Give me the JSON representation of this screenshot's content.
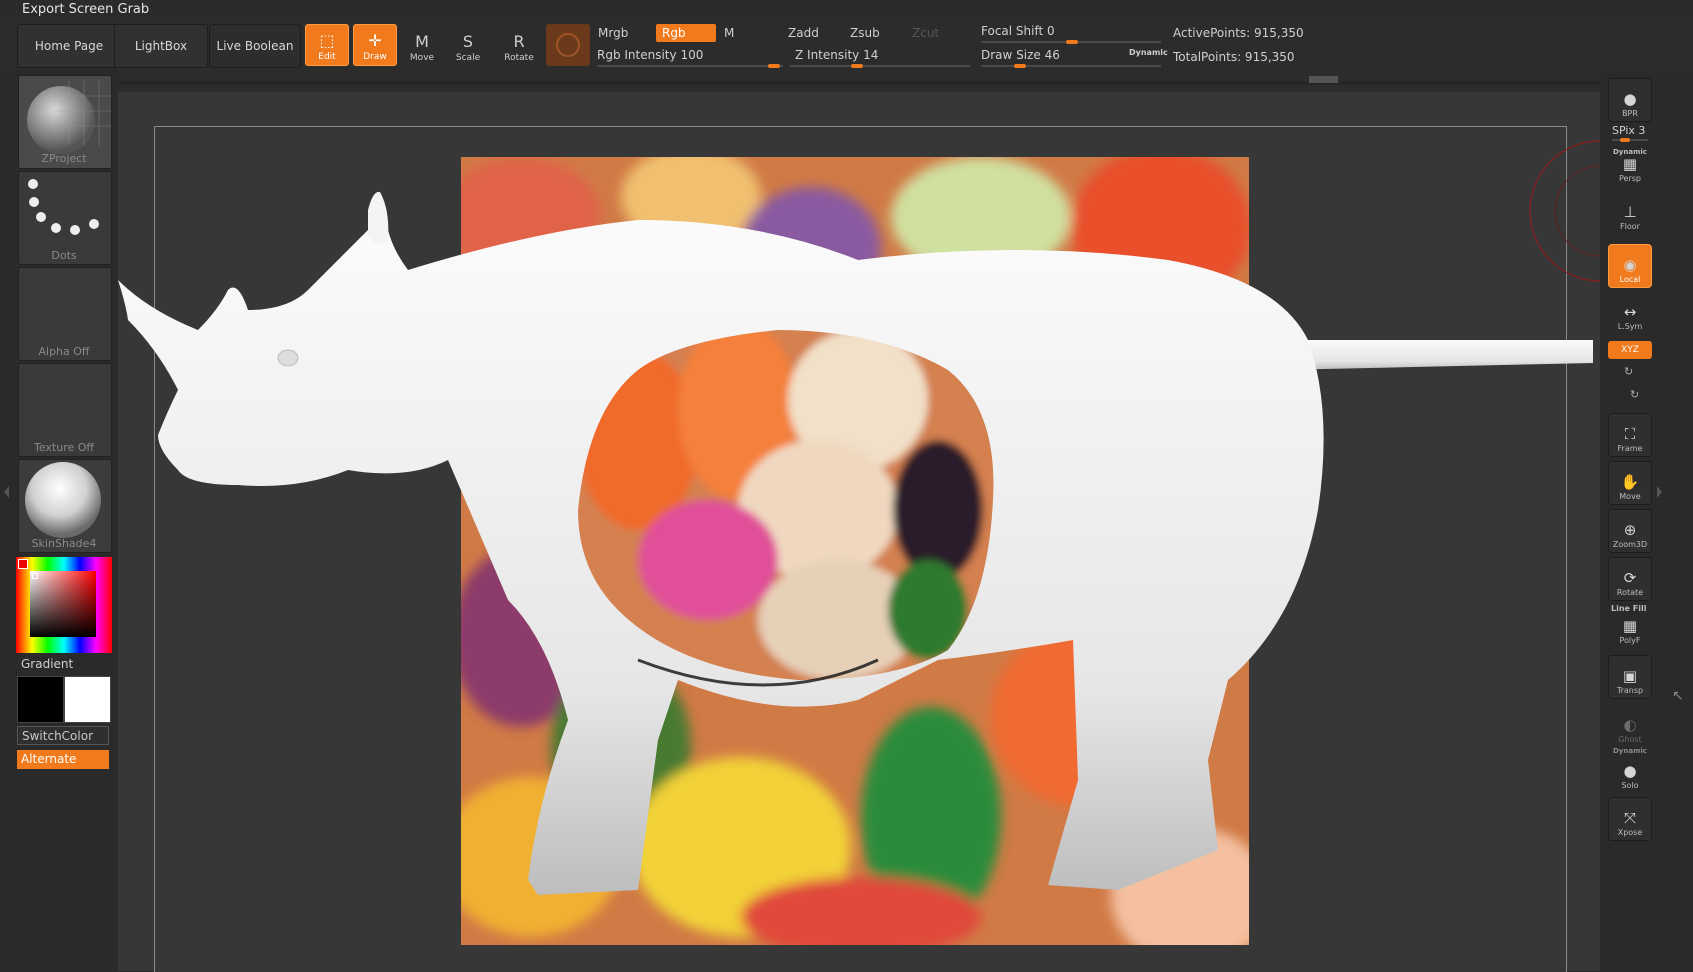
{
  "window": {
    "title": "Export Screen Grab"
  },
  "nav": {
    "home": "Home Page",
    "lightbox": "LightBox",
    "live_boolean": "Live Boolean"
  },
  "tools": [
    {
      "label": "Edit",
      "icon": "edit-icon",
      "glyph": "⬚",
      "active": true
    },
    {
      "label": "Draw",
      "icon": "draw-icon",
      "glyph": "✛",
      "active": true
    },
    {
      "label": "Move",
      "icon": "move-icon",
      "glyph": "M",
      "active": false
    },
    {
      "label": "Scale",
      "icon": "scale-icon",
      "glyph": "S",
      "active": false
    },
    {
      "label": "Rotate",
      "icon": "rotate-icon",
      "glyph": "R",
      "active": false
    }
  ],
  "color_modes": {
    "mrgb": "Mrgb",
    "rgb": "Rgb",
    "m": "M",
    "rgb_intensity_label": "Rgb Intensity",
    "rgb_intensity": "100"
  },
  "depth_modes": {
    "zadd": "Zadd",
    "zsub": "Zsub",
    "zcut": "Zcut",
    "z_intensity_label": "Z Intensity",
    "z_intensity": "14"
  },
  "brush": {
    "focal_shift_label": "Focal Shift",
    "focal_shift": "0",
    "draw_size_label": "Draw Size",
    "draw_size": "46",
    "dynamic": "Dynamic"
  },
  "stats": {
    "active_points": "ActivePoints: 915,350",
    "total_points": "TotalPoints: 915,350"
  },
  "left_panel": {
    "zproject": "ZProject",
    "dots": "Dots",
    "alpha": "Alpha Off",
    "texture": "Texture Off",
    "material": "SkinShade4",
    "gradient": "Gradient",
    "switch_color": "SwitchColor",
    "alternate": "Alternate"
  },
  "right_panel": {
    "bpr": "BPR",
    "spix": "SPix 3",
    "persp_tag": "Dynamic",
    "persp": "Persp",
    "floor": "Floor",
    "local": "Local",
    "lsym": "L.Sym",
    "xyz": "XYZ",
    "frame": "Frame",
    "move": "Move",
    "zoom3d": "Zoom3D",
    "rotate": "Rotate",
    "polyf_tag": "Line Fill",
    "polyf": "PolyF",
    "transp": "Transp",
    "ghost": "Ghost",
    "solo_tag": "Dynamic",
    "solo": "Solo",
    "xpose": "Xpose"
  },
  "colors": {
    "accent": "#f07a1c",
    "panel": "#2c2c2c",
    "canvas": "#373737"
  }
}
